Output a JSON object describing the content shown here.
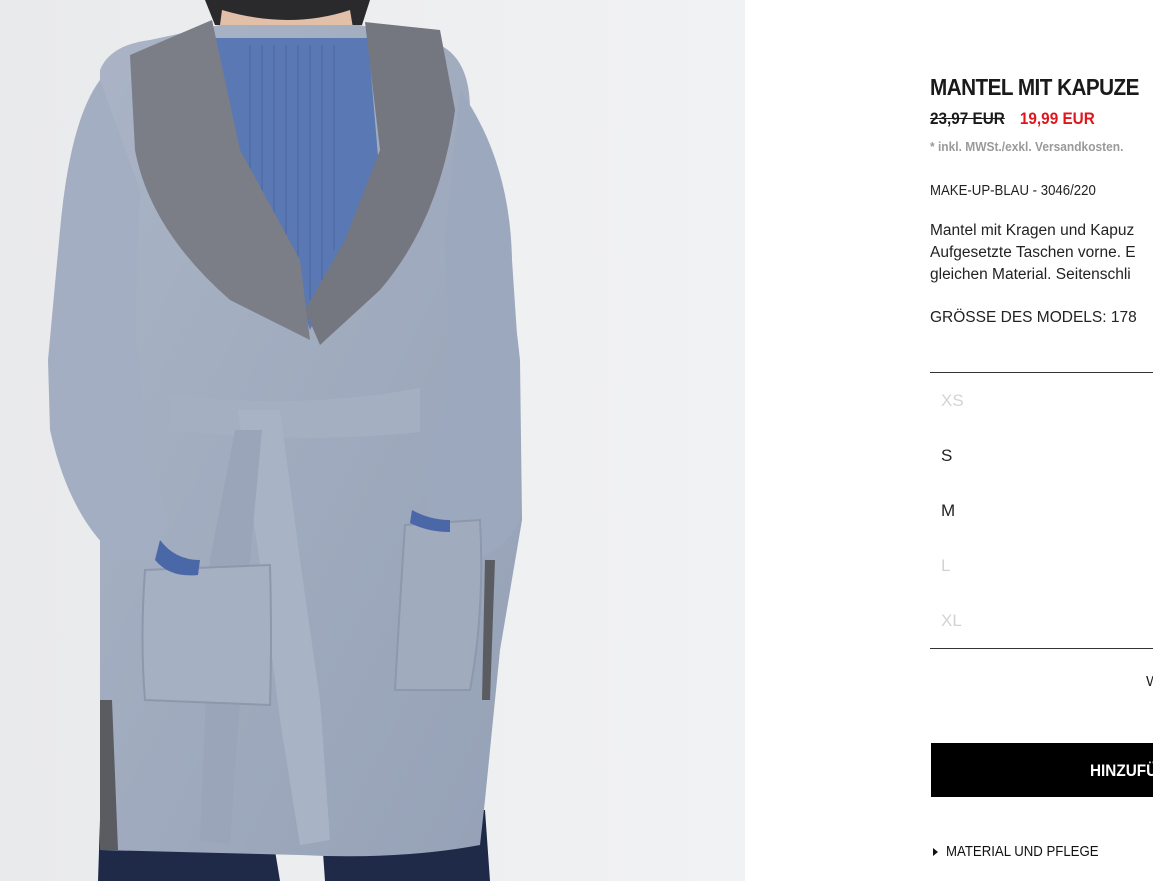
{
  "product": {
    "title": "MANTEL MIT KAPUZE",
    "old_price": "23,97 EUR",
    "new_price": "19,99 EUR",
    "tax_note": "* inkl. MWSt./exkl. Versandkosten.",
    "color_ref": "MAKE-UP-BLAU - 3046/220",
    "description_lines": [
      "Mantel mit Kragen und Kapuz",
      "Aufgesetzte Taschen vorne. E",
      "gleichen Material. Seitenschli"
    ],
    "model_size": "GRÖSSE DES MODELS: 178"
  },
  "sizes": [
    {
      "label": "XS",
      "available": false
    },
    {
      "label": "S",
      "available": true
    },
    {
      "label": "M",
      "available": true
    },
    {
      "label": "L",
      "available": false
    },
    {
      "label": "XL",
      "available": false
    }
  ],
  "size_guide_label": "W",
  "add_button_label": "HINZUFÜ",
  "material_label": "MATERIAL UND PFLEGE",
  "colors": {
    "sale_price": "#e0151c",
    "button_bg": "#000000",
    "disabled_size": "#d3d3d3"
  }
}
